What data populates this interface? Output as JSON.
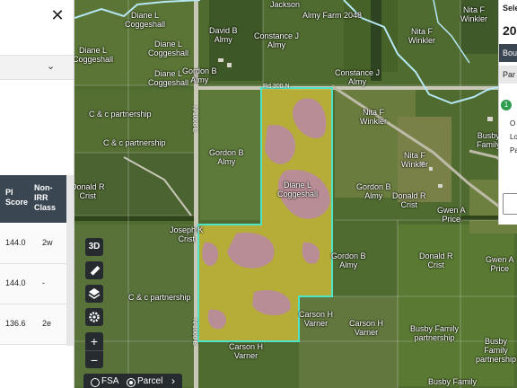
{
  "left_panel": {
    "close_label": "✕",
    "select_chevron": "⌄",
    "table": {
      "headers": {
        "pi": "PI\nScore",
        "non_irr": "Non-\nIRR\nClass"
      },
      "rows": [
        {
          "pi": "144.0",
          "cls": "2w"
        },
        {
          "pi": "144.0",
          "cls": "-"
        },
        {
          "pi": "136.6",
          "cls": "2e"
        }
      ]
    }
  },
  "map": {
    "road_labels": {
      "rd300n": "Rd 300 N",
      "n_rd_top": "N 1000 E",
      "n_rd_bottom": "N 1000 E"
    },
    "owners": [
      {
        "name": "Diane L\nCoggeshall"
      },
      {
        "name": "Diane L\nCoggeshall"
      },
      {
        "name": "Diane L\nCoggeshall"
      },
      {
        "name": "Diane L\nCoggeshall"
      },
      {
        "name": "Diane L\nCoggeshall"
      },
      {
        "name": "David B\nAlmy"
      },
      {
        "name": "Constance J\nAlmy"
      },
      {
        "name": "Almy Farm 2048"
      },
      {
        "name": "Jackson"
      },
      {
        "name": "Nita F\nWinkler"
      },
      {
        "name": "Nita F\nWinkler"
      },
      {
        "name": "Nita F\nWinkler"
      },
      {
        "name": "Nita F\nWinkler"
      },
      {
        "name": "Gordon B\nAlmy"
      },
      {
        "name": "Gordon B\nAlmy"
      },
      {
        "name": "Gordon B\nAlmy"
      },
      {
        "name": "Gordon B\nAlmy"
      },
      {
        "name": "Constance J\nAlmy"
      },
      {
        "name": "C & c partnership"
      },
      {
        "name": "C & c partnership"
      },
      {
        "name": "C & c partnership"
      },
      {
        "name": "Donald R\nCrist"
      },
      {
        "name": "Donald R\nCrist"
      },
      {
        "name": "Donald R\nCrist"
      },
      {
        "name": "Joseph K\nCrist"
      },
      {
        "name": "Gwen A\nPrice"
      },
      {
        "name": "Gwen A\nPrice"
      },
      {
        "name": "Busby\nFamily"
      },
      {
        "name": "Busby Family\npartnership"
      },
      {
        "name": "Busby Family\npartnership"
      },
      {
        "name": "Carson H\nVarner"
      },
      {
        "name": "Carson H\nVarner"
      },
      {
        "name": "Carson H\nVarner"
      },
      {
        "name": "Busby Family"
      }
    ],
    "controls": {
      "btn_3d": "3D",
      "ruler_icon": "ruler-icon",
      "layers_icon": "layers-icon",
      "settings_icon": "gear-icon",
      "zoom_in": "+",
      "zoom_out": "−",
      "layer_fsa": "FSA",
      "layer_parcel": "Parcel",
      "layer_next": "›"
    }
  },
  "right_panel": {
    "select_label": "Sele",
    "year": "20",
    "bou_tab": "Bou",
    "par_tab": "Par",
    "step": "1",
    "list": [
      "O",
      "Lo",
      "Pa"
    ]
  },
  "colors": {
    "parcel_outline": "#4fe3c8",
    "parcel_fill": "#c8b93a",
    "soil_pink": "#b98aa0",
    "header_bg": "#3b4653",
    "river": "#b7e7f5"
  }
}
